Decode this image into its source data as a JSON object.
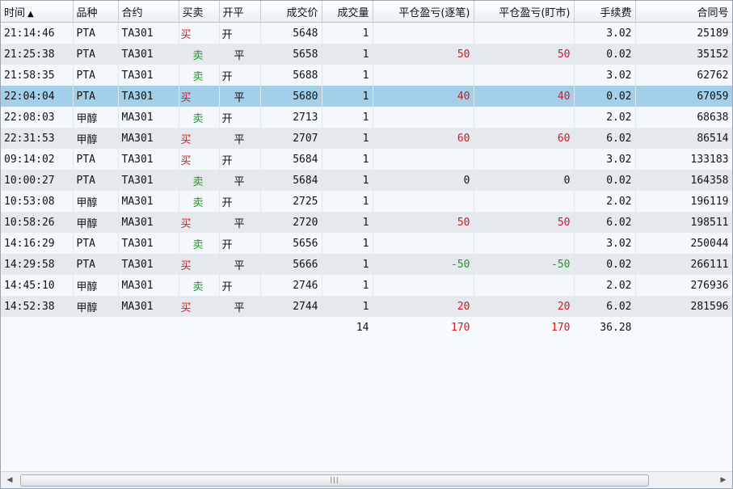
{
  "columns": [
    {
      "key": "time",
      "label": "时间"
    },
    {
      "key": "variety",
      "label": "品种"
    },
    {
      "key": "contract",
      "label": "合约"
    },
    {
      "key": "direction",
      "label": "买卖"
    },
    {
      "key": "openclose",
      "label": "开平"
    },
    {
      "key": "price",
      "label": "成交价"
    },
    {
      "key": "volume",
      "label": "成交量"
    },
    {
      "key": "pnl_trade",
      "label": "平仓盈亏(逐笔)"
    },
    {
      "key": "pnl_mtm",
      "label": "平仓盈亏(盯市)"
    },
    {
      "key": "fee",
      "label": "手续费"
    },
    {
      "key": "contract_no",
      "label": "合同号"
    }
  ],
  "sort": {
    "column": "time",
    "indicator": "▲"
  },
  "selected_row": 3,
  "rows": [
    {
      "time": "21:14:46",
      "variety": "PTA",
      "contract": "TA301",
      "direction": "买",
      "openclose": "开",
      "price": "5648",
      "volume": "1",
      "pnl_trade": "",
      "pnl_mtm": "",
      "fee": "3.02",
      "contract_no": "25189"
    },
    {
      "time": "21:25:38",
      "variety": "PTA",
      "contract": "TA301",
      "direction": "卖",
      "openclose": "平",
      "price": "5658",
      "volume": "1",
      "pnl_trade": "50",
      "pnl_mtm": "50",
      "fee": "0.02",
      "contract_no": "35152"
    },
    {
      "time": "21:58:35",
      "variety": "PTA",
      "contract": "TA301",
      "direction": "卖",
      "openclose": "开",
      "price": "5688",
      "volume": "1",
      "pnl_trade": "",
      "pnl_mtm": "",
      "fee": "3.02",
      "contract_no": "62762"
    },
    {
      "time": "22:04:04",
      "variety": "PTA",
      "contract": "TA301",
      "direction": "买",
      "openclose": "平",
      "price": "5680",
      "volume": "1",
      "pnl_trade": "40",
      "pnl_mtm": "40",
      "fee": "0.02",
      "contract_no": "67059"
    },
    {
      "time": "22:08:03",
      "variety": "甲醇",
      "contract": "MA301",
      "direction": "卖",
      "openclose": "开",
      "price": "2713",
      "volume": "1",
      "pnl_trade": "",
      "pnl_mtm": "",
      "fee": "2.02",
      "contract_no": "68638"
    },
    {
      "time": "22:31:53",
      "variety": "甲醇",
      "contract": "MA301",
      "direction": "买",
      "openclose": "平",
      "price": "2707",
      "volume": "1",
      "pnl_trade": "60",
      "pnl_mtm": "60",
      "fee": "6.02",
      "contract_no": "86514"
    },
    {
      "time": "09:14:02",
      "variety": "PTA",
      "contract": "TA301",
      "direction": "买",
      "openclose": "开",
      "price": "5684",
      "volume": "1",
      "pnl_trade": "",
      "pnl_mtm": "",
      "fee": "3.02",
      "contract_no": "133183"
    },
    {
      "time": "10:00:27",
      "variety": "PTA",
      "contract": "TA301",
      "direction": "卖",
      "openclose": "平",
      "price": "5684",
      "volume": "1",
      "pnl_trade": "0",
      "pnl_mtm": "0",
      "fee": "0.02",
      "contract_no": "164358"
    },
    {
      "time": "10:53:08",
      "variety": "甲醇",
      "contract": "MA301",
      "direction": "卖",
      "openclose": "开",
      "price": "2725",
      "volume": "1",
      "pnl_trade": "",
      "pnl_mtm": "",
      "fee": "2.02",
      "contract_no": "196119"
    },
    {
      "time": "10:58:26",
      "variety": "甲醇",
      "contract": "MA301",
      "direction": "买",
      "openclose": "平",
      "price": "2720",
      "volume": "1",
      "pnl_trade": "50",
      "pnl_mtm": "50",
      "fee": "6.02",
      "contract_no": "198511"
    },
    {
      "time": "14:16:29",
      "variety": "PTA",
      "contract": "TA301",
      "direction": "卖",
      "openclose": "开",
      "price": "5656",
      "volume": "1",
      "pnl_trade": "",
      "pnl_mtm": "",
      "fee": "3.02",
      "contract_no": "250044"
    },
    {
      "time": "14:29:58",
      "variety": "PTA",
      "contract": "TA301",
      "direction": "买",
      "openclose": "平",
      "price": "5666",
      "volume": "1",
      "pnl_trade": "-50",
      "pnl_mtm": "-50",
      "fee": "0.02",
      "contract_no": "266111"
    },
    {
      "time": "14:45:10",
      "variety": "甲醇",
      "contract": "MA301",
      "direction": "卖",
      "openclose": "开",
      "price": "2746",
      "volume": "1",
      "pnl_trade": "",
      "pnl_mtm": "",
      "fee": "2.02",
      "contract_no": "276936"
    },
    {
      "time": "14:52:38",
      "variety": "甲醇",
      "contract": "MA301",
      "direction": "买",
      "openclose": "平",
      "price": "2744",
      "volume": "1",
      "pnl_trade": "20",
      "pnl_mtm": "20",
      "fee": "6.02",
      "contract_no": "281596"
    }
  ],
  "totals": {
    "volume": "14",
    "pnl_trade": "170",
    "pnl_mtm": "170",
    "fee": "36.28"
  },
  "scrollbar": {
    "grip": "|||"
  },
  "colors": {
    "buy": "#e0141a",
    "sell": "#1c9c1c",
    "profit": "#e0141a",
    "loss": "#1c9c1c",
    "selection": "#a3cfe8"
  }
}
